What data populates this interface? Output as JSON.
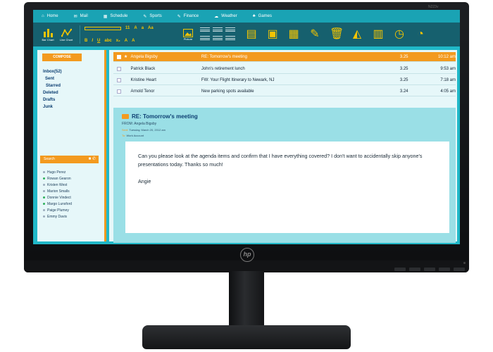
{
  "monitor": {
    "brand_logo": "hp",
    "model": "N223v"
  },
  "menubar": [
    {
      "icon": "home-icon",
      "label": "Home"
    },
    {
      "icon": "mail-icon",
      "label": "Mail"
    },
    {
      "icon": "calendar-icon",
      "label": "Schedule"
    },
    {
      "icon": "sports-icon",
      "label": "Sports"
    },
    {
      "icon": "finance-icon",
      "label": "Finance"
    },
    {
      "icon": "weather-icon",
      "label": "Weather"
    },
    {
      "icon": "games-icon",
      "label": "Games"
    }
  ],
  "ribbon": {
    "bar_chart": "Bar Chart",
    "line_chart": "Line Chart",
    "font_size": "11",
    "picture": "Picture",
    "tools": [
      "clipboard-icon",
      "save-icon",
      "calendar-icon",
      "edit-icon",
      "trash-icon",
      "chart-icon",
      "briefcase-icon",
      "clock-icon",
      "alarm-icon"
    ]
  },
  "sidebar": {
    "compose": "COMPOSE",
    "folders": [
      "Inbox(52)",
      "Sent",
      "Starred",
      "Deleted",
      "Drafts",
      "Junk"
    ],
    "search_placeholder": "Search",
    "contacts": [
      {
        "name": "Hugo Perez",
        "online": false
      },
      {
        "name": "Rowan Gearon",
        "online": true
      },
      {
        "name": "Kristen West",
        "online": false
      },
      {
        "name": "Marion Smalls",
        "online": false
      },
      {
        "name": "Donnie Vindect",
        "online": true
      },
      {
        "name": "Margo Lunsford",
        "online": true
      },
      {
        "name": "Paige Plumey",
        "online": false
      },
      {
        "name": "Emmy Davis",
        "online": false
      }
    ]
  },
  "messages": [
    {
      "from": "Angela Bigsby",
      "subject": "RE: Tomorrow's meeting",
      "size": "3.25",
      "time": "10:12 am",
      "selected": true
    },
    {
      "from": "Patrick Black",
      "subject": "John's retirement lunch",
      "size": "3.25",
      "time": "9:53 am",
      "selected": false
    },
    {
      "from": "Kristine Heart",
      "subject": "FW: Your Flight Itinerary to Newark, NJ",
      "size": "3.25",
      "time": "7:18 am",
      "selected": false
    },
    {
      "from": "Arnold Tenor",
      "subject": "New parking spots available",
      "size": "3.24",
      "time": "4:05 am",
      "selected": false
    }
  ],
  "reading": {
    "title": "RE: Tomorrow's meeting",
    "from": "FROM: Angela Bigsby",
    "sent_label": "Sent:",
    "sent": "Tuesday, March 20, 2012 am",
    "to_label": "To:",
    "to": "Work Account",
    "body": "Can you please look at the agenda items and confirm that I have everything covered? I don't want to accidentally skip anyone's presentations today. Thanks so much!",
    "signature": "Angie"
  }
}
